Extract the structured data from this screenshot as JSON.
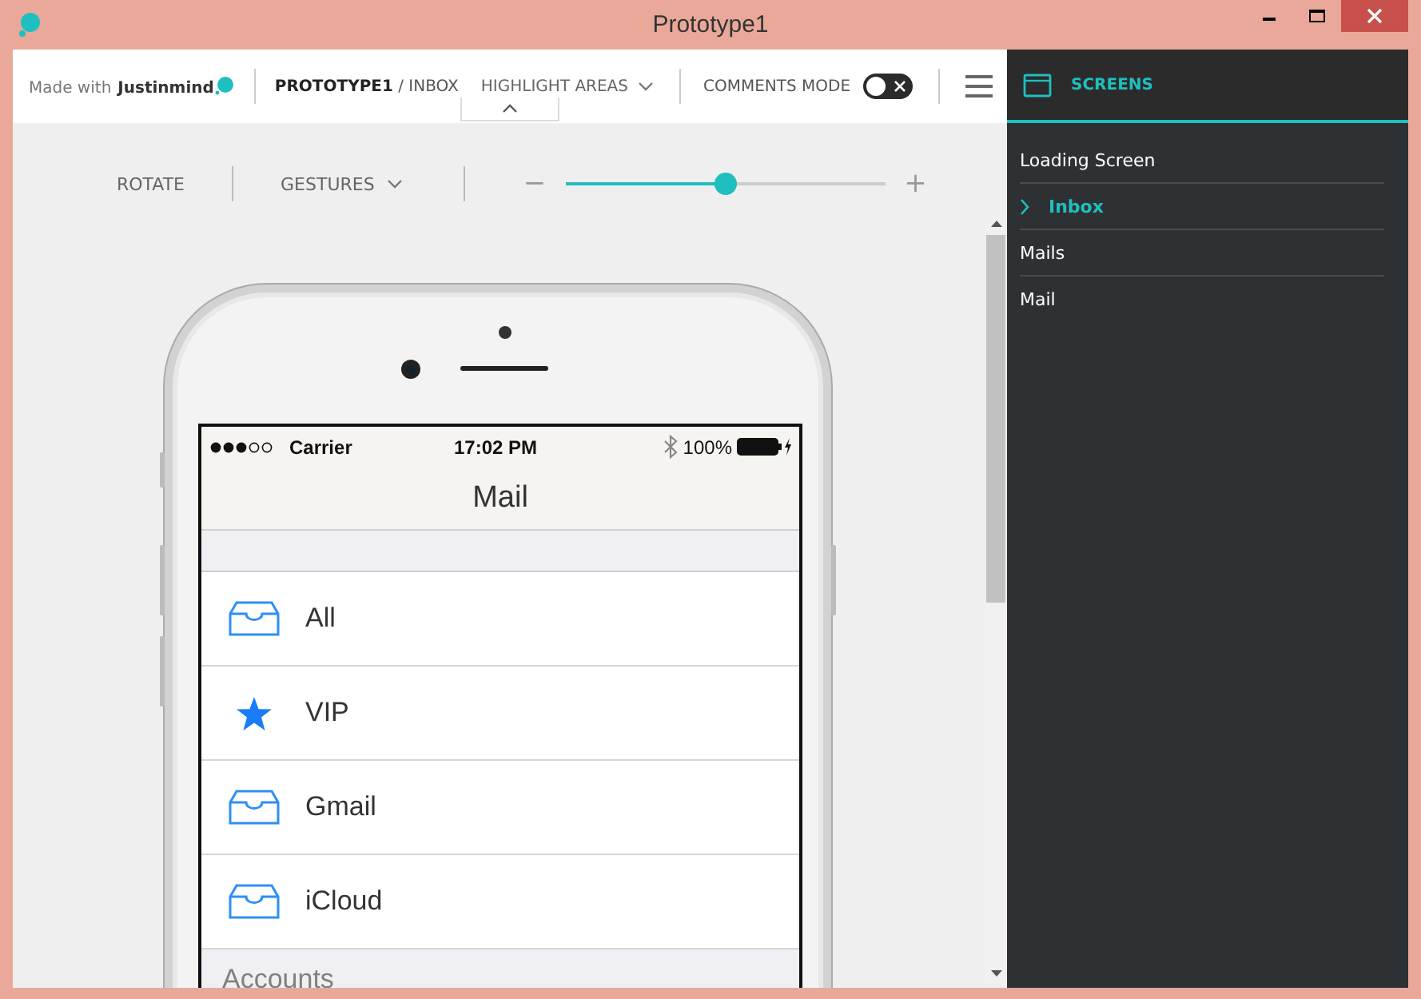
{
  "window": {
    "title": "Prototype1"
  },
  "toolbar": {
    "brand_prefix": "Made with",
    "brand_name": "Justinmind",
    "breadcrumb": "**PROTOTYPE1** / INBOX",
    "highlight_areas": "HIGHLIGHT AREAS",
    "comments_mode": {
      "label": "COMMENTS MODE",
      "on": false
    }
  },
  "controls": {
    "rotate": "ROTATE",
    "gestures": "GESTURES",
    "zoom": {
      "minus": "−",
      "plus": "+",
      "level": 0.5
    }
  },
  "phone": {
    "status_bar": {
      "carrier": "Carrier",
      "time": "17:02 PM",
      "battery": "100%"
    },
    "nav_title": "Mail",
    "mailboxes": [
      {
        "label": "All",
        "kind": "inbox"
      },
      {
        "label": "VIP",
        "kind": "star"
      },
      {
        "label": "Gmail",
        "kind": "inbox"
      },
      {
        "label": "iCloud",
        "kind": "inbox"
      }
    ],
    "section": "Accounts"
  },
  "sidebar": {
    "title": "SCREENS",
    "items": [
      {
        "label": "Loading Screen",
        "selected": false
      },
      {
        "label": "Inbox",
        "selected": true
      },
      {
        "label": "Mails",
        "selected": false
      },
      {
        "label": "Mail",
        "selected": false
      }
    ]
  }
}
